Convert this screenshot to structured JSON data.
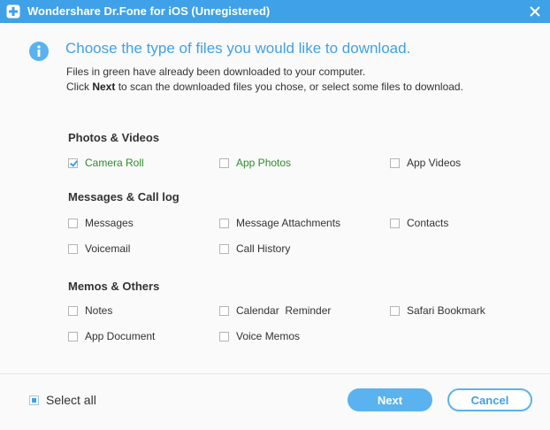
{
  "window": {
    "title": "Wondershare Dr.Fone for iOS (Unregistered)"
  },
  "heading": "Choose the type of files you would like to download.",
  "description": {
    "line1": "Files in green have already been downloaded to your computer.",
    "line2_prefix": "Click ",
    "line2_bold": "Next",
    "line2_suffix": " to scan the downloaded files you chose, or select some files to download."
  },
  "sections": {
    "photos": {
      "title": "Photos & Videos",
      "camera_roll": {
        "label": "Camera Roll",
        "checked": true,
        "downloaded": true
      },
      "app_photos": {
        "label": "App Photos",
        "checked": false,
        "downloaded": true
      },
      "app_videos": {
        "label": "App Videos",
        "checked": false,
        "downloaded": false
      }
    },
    "messages": {
      "title": "Messages & Call log",
      "messages": {
        "label": "Messages",
        "checked": false
      },
      "message_attachments": {
        "label": "Message Attachments",
        "checked": false
      },
      "contacts": {
        "label": "Contacts",
        "checked": false
      },
      "voicemail": {
        "label": "Voicemail",
        "checked": false
      },
      "call_history": {
        "label": "Call History",
        "checked": false
      }
    },
    "memos": {
      "title": "Memos & Others",
      "notes": {
        "label": "Notes",
        "checked": false
      },
      "calendar_reminder": {
        "label": "Calendar  Reminder",
        "checked": false
      },
      "safari_bookmark": {
        "label": "Safari Bookmark",
        "checked": false
      },
      "app_document": {
        "label": "App Document",
        "checked": false
      },
      "voice_memos": {
        "label": "Voice Memos",
        "checked": false
      }
    }
  },
  "footer": {
    "select_all": "Select all",
    "next": "Next",
    "cancel": "Cancel"
  },
  "colors": {
    "accent": "#3fa1e8",
    "downloaded_text": "#2e8b2e"
  }
}
